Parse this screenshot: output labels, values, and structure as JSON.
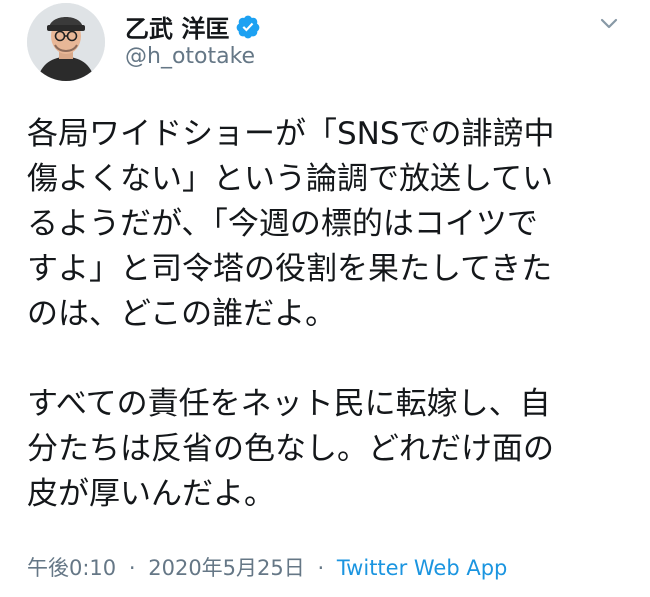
{
  "author": {
    "name": "乙武 洋匡",
    "handle": "@h_ototake",
    "verified": true,
    "verified_color": "#1da1f2"
  },
  "tweet": {
    "lines": [
      "各局ワイドショーが「SNSでの誹謗中",
      "傷よくない」という論調で放送してい",
      "るようだが、「今週の標的はコイツで",
      "すよ」と司令塔の役割を果たしてきた",
      "のは、どこの誰だよ。",
      "",
      "すべての責任をネット民に転嫁し、自",
      "分たちは反省の色なし。どれだけ面の",
      "皮が厚いんだよ。"
    ]
  },
  "meta": {
    "time": "午後0:10",
    "separator": "·",
    "date": "2020年5月25日",
    "source": "Twitter Web App"
  },
  "colors": {
    "text": "#14171a",
    "secondary": "#657786",
    "link": "#1b95e0"
  }
}
